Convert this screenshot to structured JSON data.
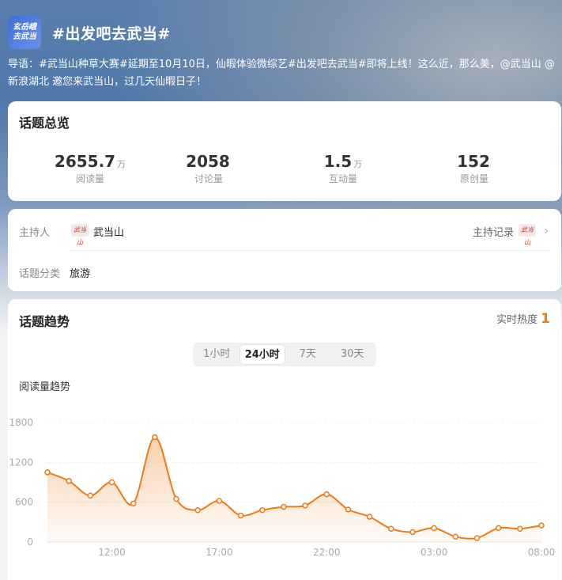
{
  "header": {
    "logo_text_line1": "玄岳峨",
    "logo_text_line2": "去武当",
    "title": "#出发吧去武当#",
    "intro": "导语：#武当山种草大赛#延期至10月10日，仙暇体验微综艺#出发吧去武当#即将上线！这么近，那么美，@武当山 @新浪湖北 邀您来武当山，过几天仙暇日子！"
  },
  "overview": {
    "title": "话题总览",
    "stats": [
      {
        "value": "2655.7",
        "unit": "万",
        "label": "阅读量"
      },
      {
        "value": "2058",
        "unit": "",
        "label": "讨论量"
      },
      {
        "value": "1.5",
        "unit": "万",
        "label": "互动量"
      },
      {
        "value": "152",
        "unit": "",
        "label": "原创量"
      }
    ]
  },
  "host": {
    "host_label": "主持人",
    "host_avatar_text": "武当山",
    "host_name": "武当山",
    "record_label": "主持记录",
    "record_avatar_text": "武当山",
    "category_label": "话题分类",
    "category_value": "旅游"
  },
  "trend": {
    "title": "话题趋势",
    "heat_label": "实时热度",
    "heat_value": "1",
    "tabs": [
      "1小时",
      "24小时",
      "7天",
      "30天"
    ],
    "active_tab": "24小时",
    "metric_label": "阅读量趋势"
  },
  "colors": {
    "accent": "#f07d00",
    "line": "#ee7a16"
  },
  "chart_data": {
    "type": "area",
    "title": "",
    "xlabel": "",
    "ylabel": "",
    "x_tick_labels": [
      "12:00",
      "17:00",
      "22:00",
      "03:00",
      "08:00"
    ],
    "y_tick_labels": [
      "0",
      "600",
      "1200",
      "1800"
    ],
    "ylim": [
      0,
      1800
    ],
    "grid": true,
    "series": [
      {
        "values": [
          1050,
          920,
          700,
          900,
          580,
          1580,
          650,
          480,
          620,
          400,
          480,
          530,
          550,
          720,
          490,
          380,
          200,
          150,
          210,
          80,
          60,
          210,
          200,
          250
        ]
      }
    ]
  }
}
